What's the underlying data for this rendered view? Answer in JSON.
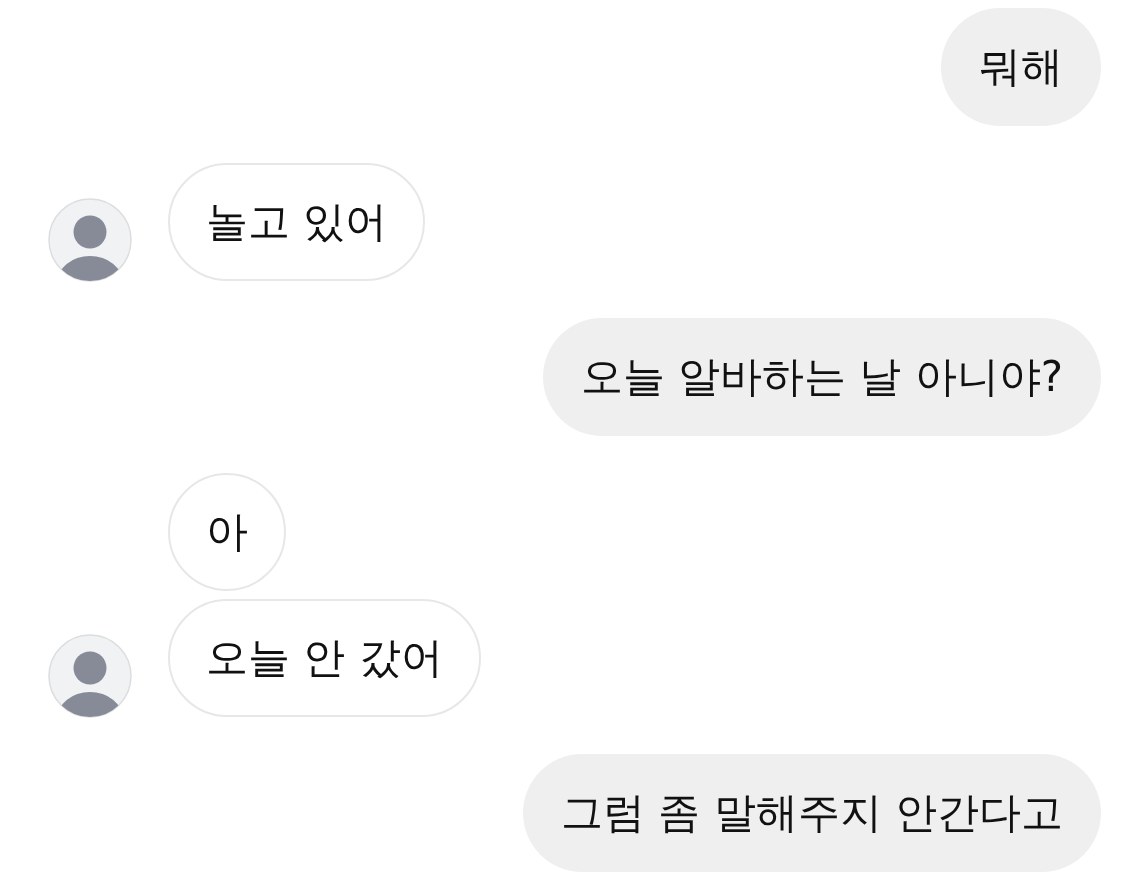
{
  "messages": [
    {
      "kind": "sent",
      "text": "뭐해",
      "show_avatar": false
    },
    {
      "kind": "received",
      "text": "놀고 있어",
      "show_avatar": true
    },
    {
      "kind": "sent",
      "text": "오늘 알바하는 날 아니야?",
      "show_avatar": false
    },
    {
      "kind": "received",
      "text": "아",
      "show_avatar": false
    },
    {
      "kind": "received",
      "text": "오늘 안 갔어",
      "show_avatar": true
    },
    {
      "kind": "sent",
      "text": "그럼 좀 말해주지 안간다고",
      "show_avatar": false
    }
  ]
}
